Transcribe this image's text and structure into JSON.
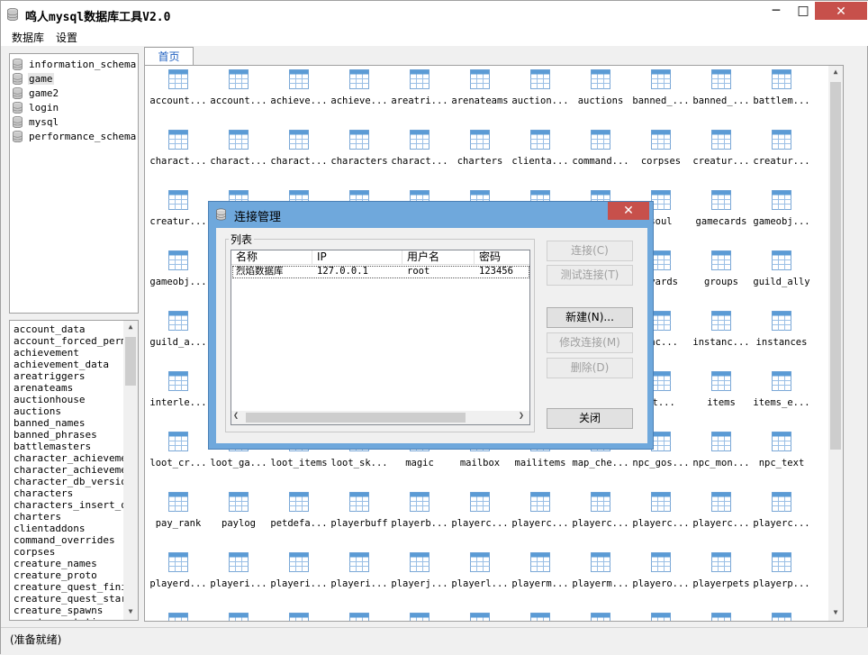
{
  "window": {
    "title": "鸣人mysql数据库工具V2.0"
  },
  "menu": [
    "数据库",
    "设置"
  ],
  "databases": [
    {
      "name": "information_schema"
    },
    {
      "name": "game",
      "selected": true
    },
    {
      "name": "game2"
    },
    {
      "name": "login"
    },
    {
      "name": "mysql"
    },
    {
      "name": "performance_schema"
    }
  ],
  "table_list": [
    "account_data",
    "account_forced_permis",
    "achievement",
    "achievement_data",
    "areatriggers",
    "arenateams",
    "auctionhouse",
    "auctions",
    "banned_names",
    "banned_phrases",
    "battlemasters",
    "character_achievement",
    "character_achievement",
    "character_db_version",
    "characters",
    "characters_insert_que",
    "charters",
    "clientaddons",
    "command_overrides",
    "corpses",
    "creature_names",
    "creature_proto",
    "creature_quest_finish",
    "creature_quest_starte",
    "creature_spawns",
    "creature_staticspawns"
  ],
  "tab": {
    "label": "首页"
  },
  "grid_rows": [
    [
      "account...",
      "account...",
      "achieve...",
      "achieve...",
      "areatri...",
      "arenateams",
      "auction...",
      "auctions",
      "banned_...",
      "banned_...",
      "battlem..."
    ],
    [
      "charact...",
      "charact...",
      "charact...",
      "characters",
      "charact...",
      "charters",
      "clienta...",
      "command...",
      "corpses",
      "creatur...",
      "creatur..."
    ],
    [
      "creatur...",
      "",
      "",
      "",
      "",
      "",
      "",
      "",
      "soul",
      "gamecards",
      "gameobj..."
    ],
    [
      "gameobj...",
      "",
      "",
      "",
      "",
      "",
      "",
      "",
      "eyards",
      "groups",
      "guild_ally"
    ],
    [
      "guild_a...",
      "",
      "",
      "",
      "",
      "",
      "",
      "",
      "anc...",
      "instanc...",
      "instances"
    ],
    [
      "interle...",
      "",
      "",
      "",
      "",
      "",
      "",
      "",
      "et...",
      "items",
      "items_e..."
    ],
    [
      "loot_cr...",
      "loot_ga...",
      "loot_items",
      "loot_sk...",
      "magic",
      "mailbox",
      "mailitems",
      "map_che...",
      "npc_gos...",
      "npc_mon...",
      "npc_text"
    ],
    [
      "pay_rank",
      "paylog",
      "petdefa...",
      "playerbuff",
      "playerb...",
      "playerc...",
      "playerc...",
      "playerc...",
      "playerc...",
      "playerc...",
      "playerc..."
    ],
    [
      "playerd...",
      "playeri...",
      "playeri...",
      "playeri...",
      "playerj...",
      "playerl...",
      "playerm...",
      "playerm...",
      "playero...",
      "playerpets",
      "playerp..."
    ]
  ],
  "status": "(准备就绪)",
  "dialog": {
    "title": "连接管理",
    "close": "✕",
    "group_label": "列表",
    "columns": [
      "名称",
      "IP",
      "用户名",
      "密码"
    ],
    "rows": [
      {
        "name": "烈焰数据库",
        "ip": "127.0.0.1",
        "user": "root",
        "password": "123456"
      }
    ],
    "buttons": {
      "connect": "连接(C)",
      "test": "测试连接(T)",
      "new": "新建(N)...",
      "edit": "修改连接(M)",
      "delete": "删除(D)",
      "close": "关闭"
    }
  }
}
